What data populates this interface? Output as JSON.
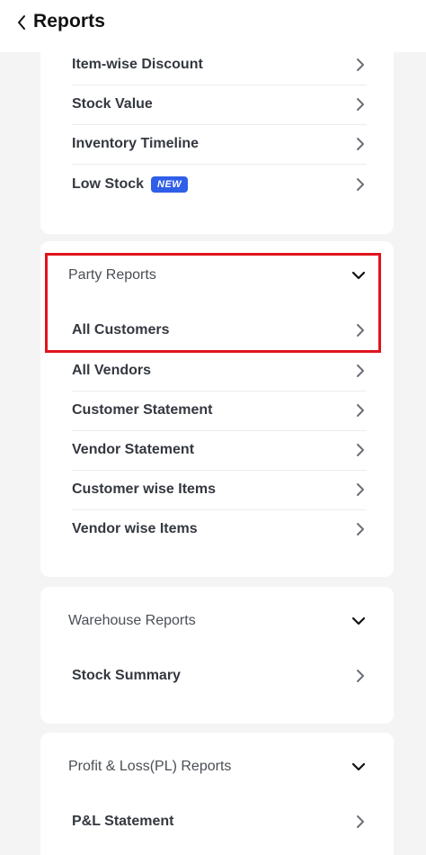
{
  "header": {
    "title": "Reports",
    "back_icon": "chevron-left-icon"
  },
  "top_section": {
    "items": [
      {
        "label": "Item-wise Discount"
      },
      {
        "label": "Stock Value"
      },
      {
        "label": "Inventory Timeline"
      },
      {
        "label": "Low Stock",
        "badge": "NEW"
      }
    ]
  },
  "party_section": {
    "title": "Party Reports",
    "items": [
      {
        "label": "All Customers"
      },
      {
        "label": "All Vendors"
      },
      {
        "label": "Customer Statement"
      },
      {
        "label": "Vendor Statement"
      },
      {
        "label": "Customer wise Items"
      },
      {
        "label": "Vendor wise Items"
      }
    ]
  },
  "warehouse_section": {
    "title": "Warehouse Reports",
    "items": [
      {
        "label": "Stock Summary"
      }
    ]
  },
  "pl_section": {
    "title": "Profit & Loss(PL) Reports",
    "items": [
      {
        "label": "P&L Statement"
      }
    ]
  },
  "colors": {
    "accent_badge": "#2f5ee8",
    "highlight_border": "#e0141d"
  }
}
